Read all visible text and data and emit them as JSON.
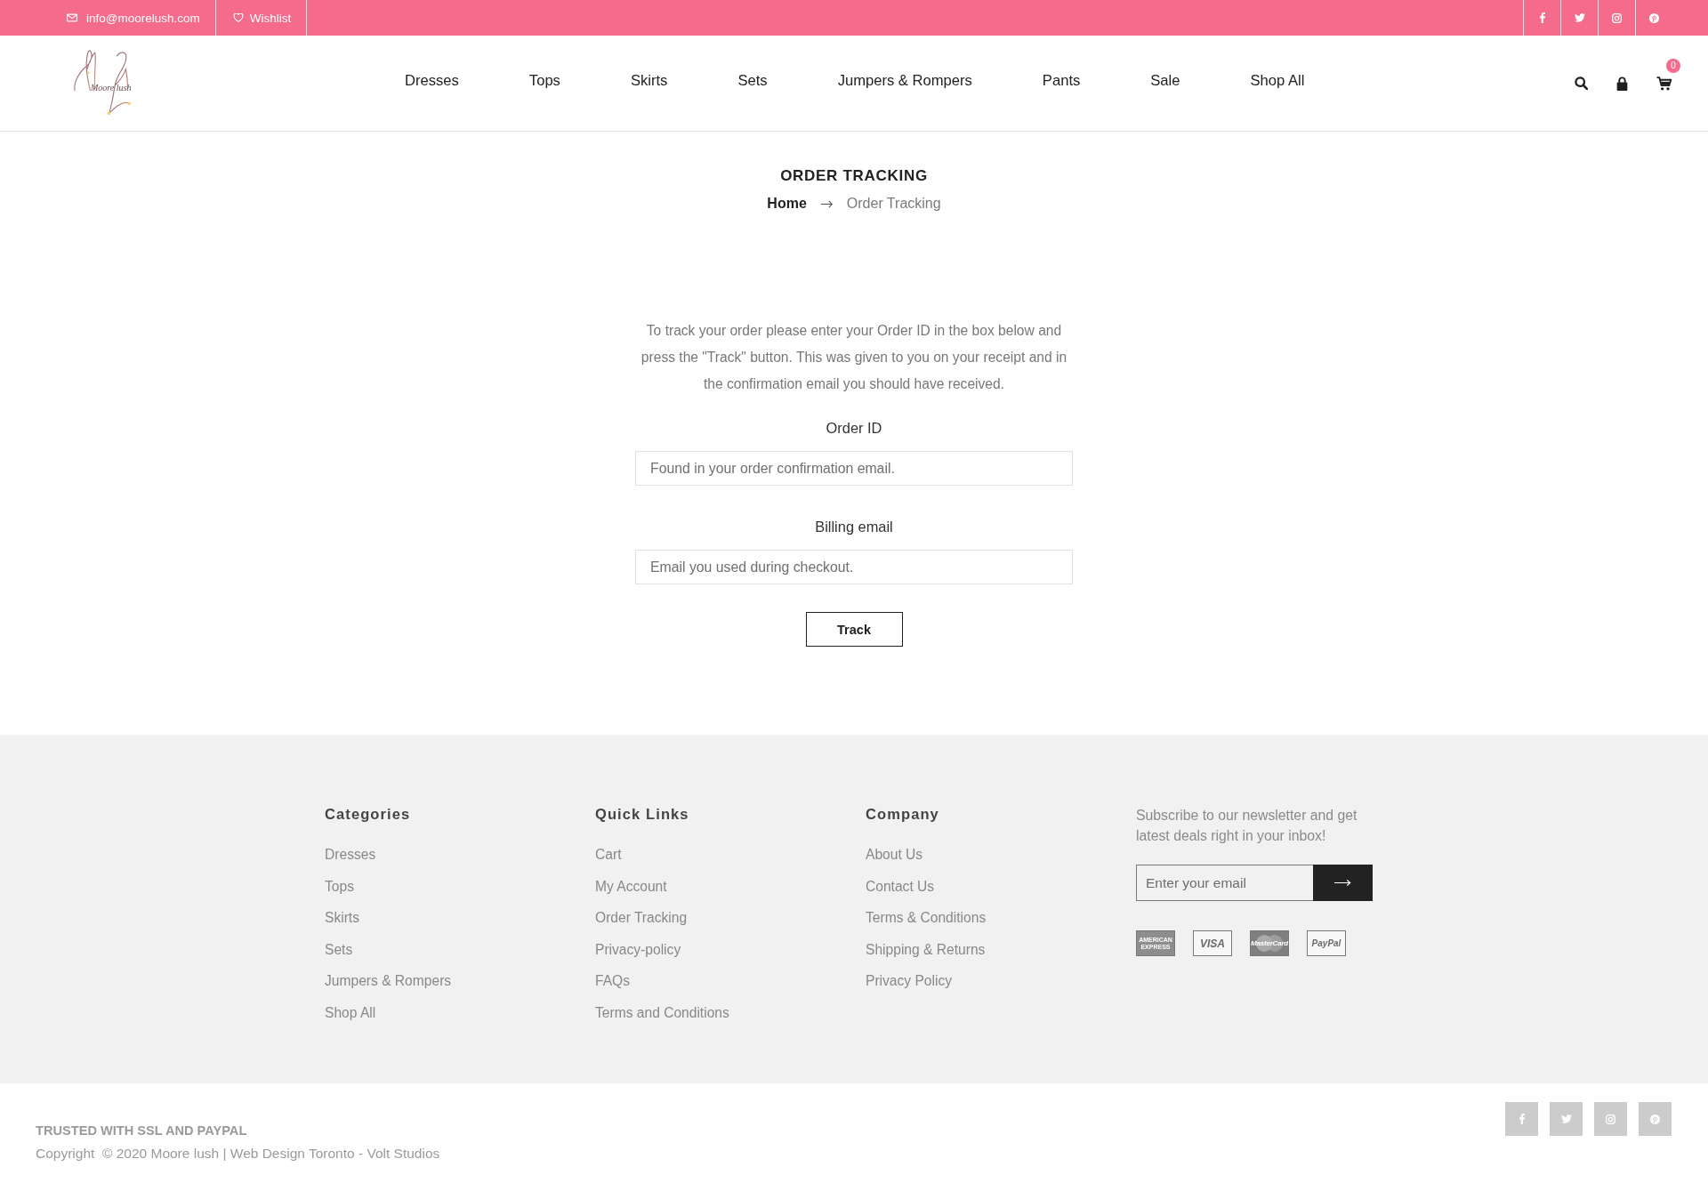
{
  "top_bar": {
    "email": "info@moorelush.com",
    "wishlist": "Wishlist"
  },
  "header": {
    "logo_text": "Moore lush",
    "nav": [
      "Dresses",
      "Tops",
      "Skirts",
      "Sets",
      "Jumpers & Rompers",
      "Pants",
      "Sale",
      "Shop All"
    ],
    "cart_count": "0"
  },
  "page_title": "ORDER TRACKING",
  "breadcrumb": [
    {
      "label": "Home",
      "current": false
    },
    {
      "label": "Order Tracking",
      "current": true
    }
  ],
  "intro": "To track your order please enter your Order ID in the box below and press the \"Track\" button. This was given to you on your receipt and in the confirmation email you should have received.",
  "form": {
    "fields": [
      {
        "label": "Order ID",
        "placeholder": "Found in your order confirmation email."
      },
      {
        "label": "Billing email",
        "placeholder": "Email you used during checkout."
      }
    ],
    "submit": "Track"
  },
  "footer": {
    "columns": [
      {
        "title": "Categories",
        "links": [
          "Dresses",
          "Tops",
          "Skirts",
          "Sets",
          "Jumpers & Rompers",
          "Shop All"
        ]
      },
      {
        "title": "Quick Links",
        "links": [
          "Cart",
          "My Account",
          "Order Tracking",
          "Privacy-policy",
          "FAQs",
          "Terms and Conditions"
        ]
      },
      {
        "title": "Company",
        "links": [
          "About Us",
          "Contact Us",
          "Terms & Conditions",
          "Shipping & Returns",
          "Privacy Policy"
        ]
      }
    ],
    "newsletter": {
      "text": "Subscribe to our newsletter and get latest deals right in your inbox!",
      "placeholder": "Enter your email"
    },
    "payment_cards": [
      {
        "kind": "amex",
        "text": "AMERICAN EXPRESS"
      },
      {
        "kind": "visa",
        "text": "VISA"
      },
      {
        "kind": "mastercard",
        "text": "MasterCard"
      },
      {
        "kind": "paypal",
        "text": "PayPal"
      }
    ]
  },
  "bottom_bar": {
    "trust": "TRUSTED WITH SSL AND PAYPAL",
    "copyright": "Copyright  © 2020 Moore lush | Web Design Toronto - Volt Studios"
  }
}
